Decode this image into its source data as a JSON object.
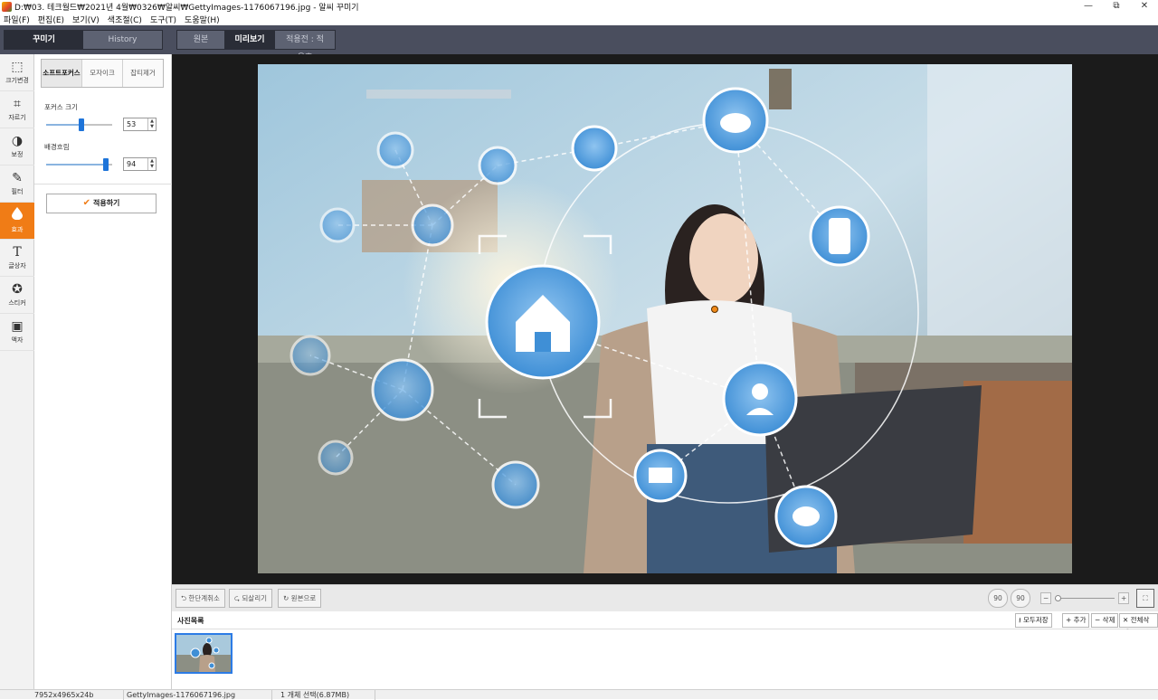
{
  "window": {
    "title": "D:₩03. 테크월드₩2021년 4월₩0326₩알씨₩GettyImages-1176067196.jpg - 알씨 꾸미기",
    "minimize": "—",
    "restore": "⧉",
    "close": "✕"
  },
  "menu": [
    "파일(F)",
    "편집(E)",
    "보기(V)",
    "색조절(C)",
    "도구(T)",
    "도움말(H)"
  ],
  "left_tabs": {
    "decorate": "꾸미기",
    "history": "History"
  },
  "view_tabs": {
    "original": "원본",
    "preview": "미리보기",
    "compare": "적용전 : 적용후"
  },
  "tools": [
    {
      "name": "resize",
      "label": "크기변경",
      "icon": "⬚"
    },
    {
      "name": "crop",
      "label": "자르기",
      "icon": "⌗"
    },
    {
      "name": "correct",
      "label": "보정",
      "icon": "◑"
    },
    {
      "name": "filter",
      "label": "필터",
      "icon": "✎"
    },
    {
      "name": "effect",
      "label": "효과",
      "icon": "💧"
    },
    {
      "name": "text",
      "label": "글상자",
      "icon": "T"
    },
    {
      "name": "sticker",
      "label": "스티커",
      "icon": "✪"
    },
    {
      "name": "frame",
      "label": "액자",
      "icon": "▣"
    }
  ],
  "effect_panel": {
    "tabs": [
      "소프트포커스",
      "모자이크",
      "잡티제거"
    ],
    "focus_size_label": "포커스 크기",
    "focus_size_value": "53",
    "focus_size_level": 0.53,
    "bg_blur_label": "배경흐림",
    "bg_blur_value": "94",
    "bg_blur_level": 0.94,
    "apply_label": "적용하기"
  },
  "bottom_controls": {
    "undo": "한단계취소",
    "redo": "되살리기",
    "revert": "원본으로",
    "rotate_left": "90",
    "rotate_right": "90",
    "zoom_out": "−",
    "zoom_in": "+"
  },
  "photo_list": {
    "title": "사진목록",
    "save_all": "모두저장",
    "add": "+ 추가",
    "delete": "− 삭제",
    "delete_all": "✕ 전체삭제"
  },
  "status": {
    "dimensions": "7952x4965x24b",
    "filename": "GettyImages-1176067196.jpg",
    "selection": "1 개체 선택(6.87MB)"
  },
  "colors": {
    "accent": "#f07c16",
    "topbar": "#4a4e5e",
    "selection": "#1e74d9"
  }
}
